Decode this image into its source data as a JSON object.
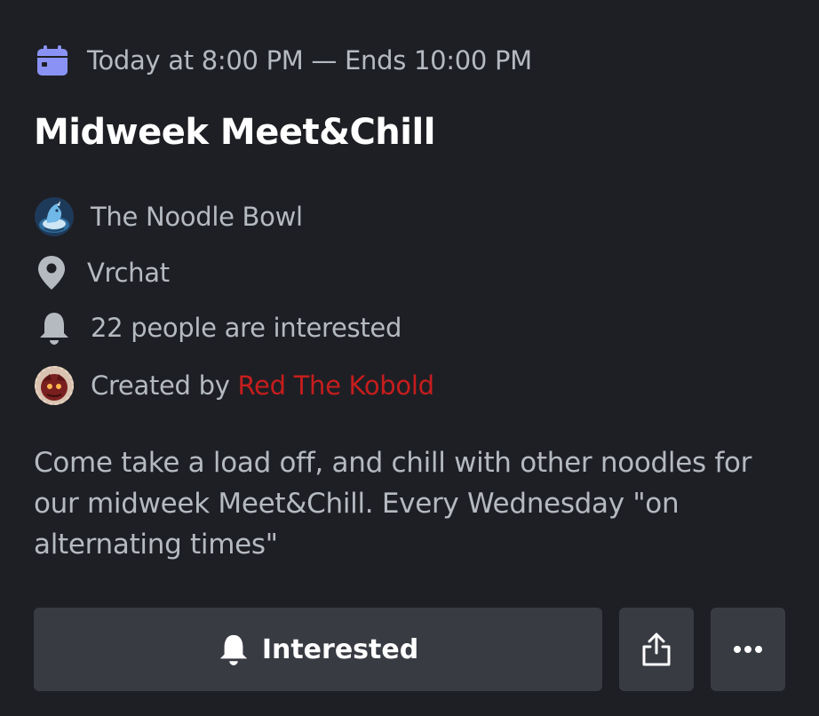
{
  "event": {
    "time": "Today at 8:00 PM — Ends 10:00 PM",
    "title": "Midweek Meet&Chill",
    "server": "The Noodle Bowl",
    "location": "Vrchat",
    "interested_count_text": "22 people are interested",
    "created_by_prefix": "Created by ",
    "creator": "Red The Kobold",
    "description": "Come take a load off, and chill with other noodles for our midweek Meet&Chill. Every Wednesday \"on alternating times\""
  },
  "actions": {
    "interested_label": "Interested"
  },
  "icons": {
    "time": "calendar-icon",
    "server": "server-avatar-icon",
    "location": "location-pin-icon",
    "interested": "bell-icon",
    "creator": "creator-avatar-icon",
    "share": "share-icon",
    "more": "more-options-icon"
  },
  "colors": {
    "background": "#1e1f24",
    "accent_calendar": "#8a93f5",
    "creator_name": "#c61d1d",
    "button_bg": "#393b43"
  }
}
